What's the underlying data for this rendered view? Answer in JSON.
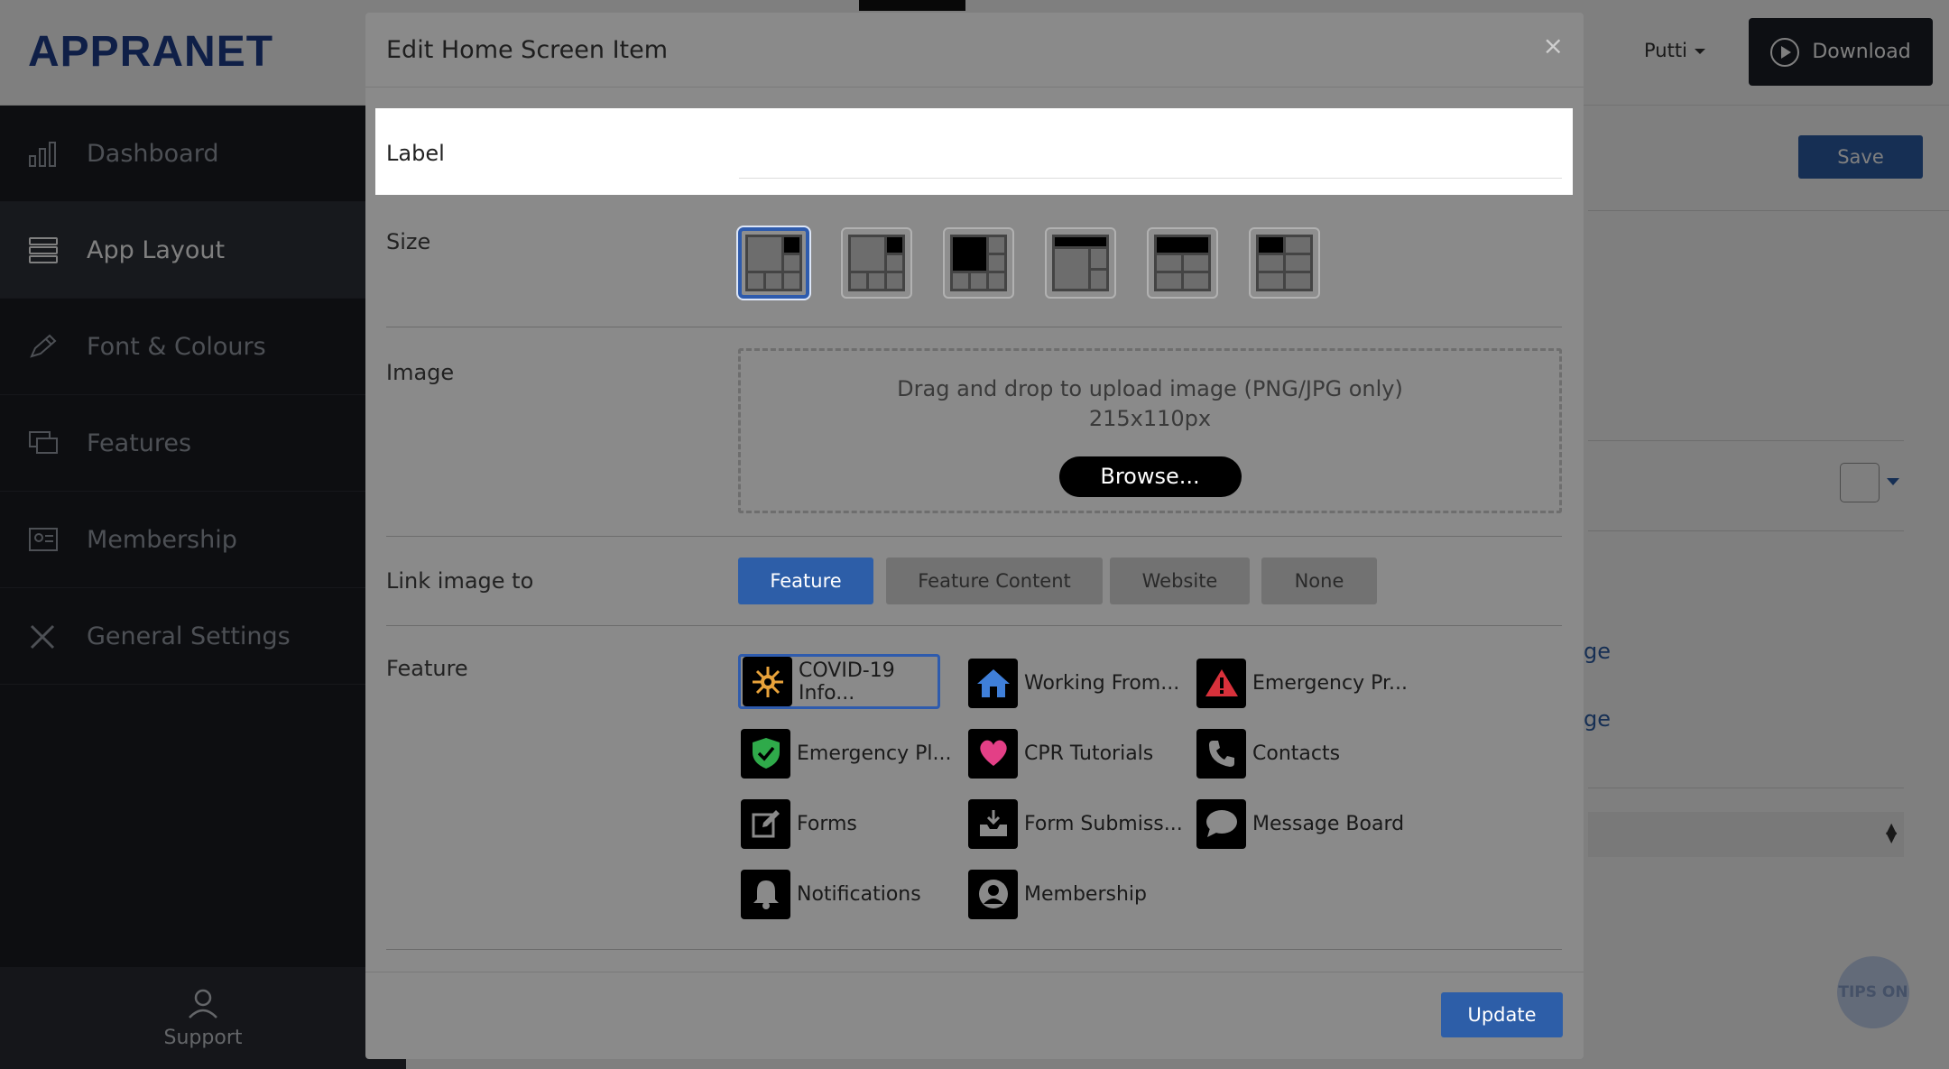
{
  "app": {
    "logo": "APPRANET",
    "user_name": "Putti",
    "download_label": "Download",
    "save_label": "Save",
    "support_label": "Support",
    "tips_label": "TIPS ON",
    "bg_link_1": "ge",
    "bg_link_2": "ge"
  },
  "sidebar": {
    "items": [
      {
        "label": "Dashboard",
        "icon": "bar-chart-icon"
      },
      {
        "label": "App Layout",
        "icon": "layers-icon",
        "active": true
      },
      {
        "label": "Font & Colours",
        "icon": "pencil-icon"
      },
      {
        "label": "Features",
        "icon": "monitor-icon"
      },
      {
        "label": "Membership",
        "icon": "id-card-icon"
      },
      {
        "label": "General Settings",
        "icon": "tools-icon"
      }
    ]
  },
  "modal": {
    "title": "Edit Home Screen Item",
    "close_symbol": "×",
    "label_row": {
      "label": "Label",
      "value": "",
      "placeholder": ""
    },
    "size_row": {
      "label": "Size",
      "selected_index": 0
    },
    "image_row": {
      "label": "Image",
      "drop_text": "Drag and drop to upload image (PNG/JPG only)",
      "drop_size": "215x110px",
      "browse_label": "Browse..."
    },
    "link_row": {
      "label": "Link image to",
      "options": [
        "Feature",
        "Feature Content",
        "Website",
        "None"
      ],
      "selected": "Feature"
    },
    "feature_row": {
      "label": "Feature",
      "items": [
        {
          "label": "COVID-19 Info...",
          "icon": "virus-icon",
          "color": "#e8a23a",
          "selected": true
        },
        {
          "label": "Working From...",
          "icon": "home-icon",
          "color": "#3f7fd9"
        },
        {
          "label": "Emergency Pr...",
          "icon": "warning-icon",
          "color": "#d8313b"
        },
        {
          "label": "Emergency Pl...",
          "icon": "shield-check-icon",
          "color": "#2faa4a"
        },
        {
          "label": "CPR Tutorials",
          "icon": "heart-icon",
          "color": "#e33f86"
        },
        {
          "label": "Contacts",
          "icon": "phone-icon",
          "color": "#8a8a8a"
        },
        {
          "label": "Forms",
          "icon": "edit-icon",
          "color": "#8a8a8a"
        },
        {
          "label": "Form Submiss...",
          "icon": "inbox-download-icon",
          "color": "#8a8a8a"
        },
        {
          "label": "Message Board",
          "icon": "chat-bubble-icon",
          "color": "#8a8a8a"
        },
        {
          "label": "Notifications",
          "icon": "bell-icon",
          "color": "#8a8a8a"
        },
        {
          "label": "Membership",
          "icon": "user-circle-icon",
          "color": "#8a8a8a"
        }
      ]
    },
    "update_label": "Update"
  },
  "colors": {
    "accent": "#2d5ea8",
    "sidebar_bg": "#1a1c22",
    "modal_bg": "#8a8a8a"
  }
}
